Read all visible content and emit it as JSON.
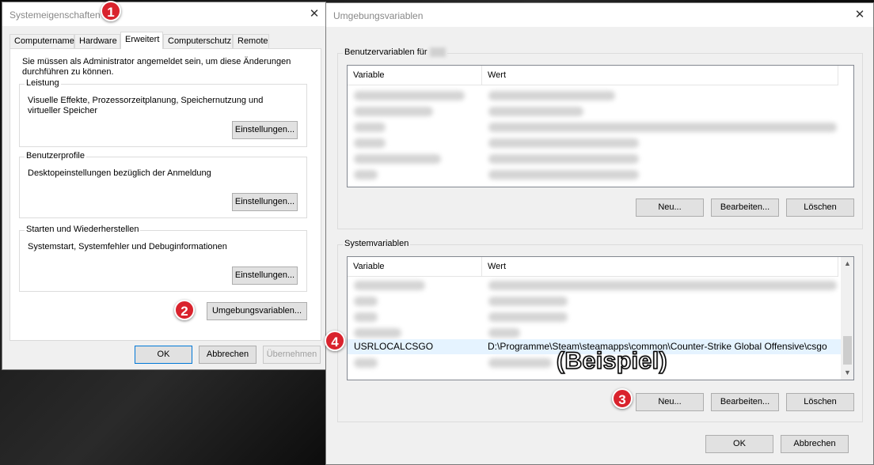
{
  "system_props": {
    "title": "Systemeigenschaften",
    "tabs": [
      "Computername",
      "Hardware",
      "Erweitert",
      "Computerschutz",
      "Remote"
    ],
    "active_tab": "Erweitert",
    "admin_note": "Sie müssen als Administrator angemeldet sein, um diese Änderungen durchführen zu können.",
    "performance": {
      "label": "Leistung",
      "desc": "Visuelle Effekte, Prozessorzeitplanung, Speichernutzung und virtueller Speicher",
      "button": "Einstellungen..."
    },
    "profiles": {
      "label": "Benutzerprofile",
      "desc": "Desktopeinstellungen bezüglich der Anmeldung",
      "button": "Einstellungen..."
    },
    "startup": {
      "label": "Starten und Wiederherstellen",
      "desc": "Systemstart, Systemfehler und Debuginformationen",
      "button": "Einstellungen..."
    },
    "env_button": "Umgebungsvariablen...",
    "ok": "OK",
    "cancel": "Abbrechen",
    "apply": "Übernehmen"
  },
  "env_vars": {
    "title": "Umgebungsvariablen",
    "user_group_label": "Benutzervariablen für",
    "system_group_label": "Systemvariablen",
    "col_variable": "Variable",
    "col_value": "Wert",
    "user_buttons": {
      "new": "Neu...",
      "edit": "Bearbeiten...",
      "delete": "Löschen"
    },
    "system_buttons": {
      "new": "Neu...",
      "edit": "Bearbeiten...",
      "delete": "Löschen"
    },
    "selected_row": {
      "variable": "USRLOCALCSGO",
      "value": "D:\\Programme\\Steam\\steamapps\\common\\Counter-Strike Global Offensive\\csgo"
    },
    "ok": "OK",
    "cancel": "Abbrechen"
  },
  "annotations": {
    "badges": [
      "1",
      "2",
      "3",
      "4"
    ],
    "example_label": "(Beispiel)",
    "badge_color": "#d9232d"
  }
}
